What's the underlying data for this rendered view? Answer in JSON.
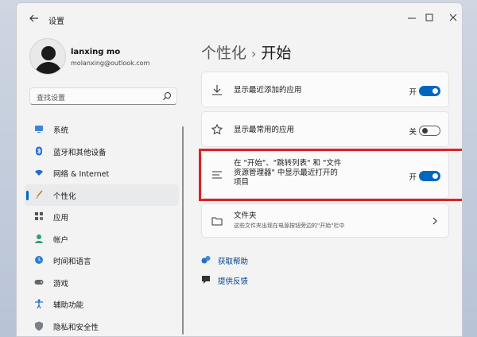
{
  "window": {
    "title": "设置"
  },
  "profile": {
    "name": "lanxing mo",
    "email": "molanxing@outlook.com"
  },
  "search": {
    "placeholder": "查找设置"
  },
  "sidebar": {
    "items": [
      {
        "label": "系统",
        "icon": "display-icon"
      },
      {
        "label": "蓝牙和其他设备",
        "icon": "bluetooth-icon"
      },
      {
        "label": "网络 & Internet",
        "icon": "wifi-icon"
      },
      {
        "label": "个性化",
        "icon": "brush-icon",
        "active": true
      },
      {
        "label": "应用",
        "icon": "apps-icon"
      },
      {
        "label": "帐户",
        "icon": "person-icon"
      },
      {
        "label": "时间和语言",
        "icon": "globe-clock-icon"
      },
      {
        "label": "游戏",
        "icon": "gamepad-icon"
      },
      {
        "label": "辅助功能",
        "icon": "accessibility-icon"
      },
      {
        "label": "隐私和安全性",
        "icon": "shield-icon"
      }
    ]
  },
  "header": {
    "parent": "个性化",
    "separator": "›",
    "current": "开始"
  },
  "settings": [
    {
      "label": "显示最近添加的应用",
      "state": "开",
      "on": true,
      "icon": "download-icon"
    },
    {
      "label": "显示最常用的应用",
      "state": "关",
      "on": false,
      "icon": "star-icon"
    },
    {
      "label_lines": [
        "在 \"开始\"、\"跳转列表\" 和 \"文件",
        "资源管理器\" 中显示最近打开的",
        "项目"
      ],
      "state": "开",
      "on": true,
      "icon": "list-icon"
    }
  ],
  "folders": {
    "label": "文件夹",
    "description": "这些文件夹出现在电源按钮旁边的\"开始\"栏中"
  },
  "links": {
    "help": "获取帮助",
    "feedback": "提供反馈"
  },
  "colors": {
    "accent": "#0067c0",
    "highlight_border": "#d9242a",
    "link": "#003e92"
  }
}
